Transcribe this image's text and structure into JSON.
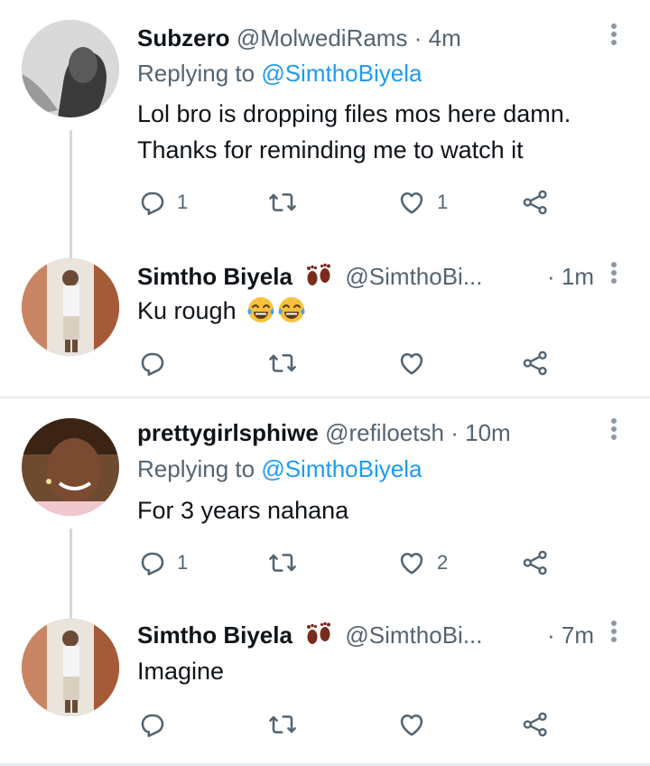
{
  "thread1": {
    "tweet1": {
      "name": "Subzero",
      "handle": "@MolwediRams",
      "separator": "·",
      "time": "4m",
      "replying_prefix": "Replying to",
      "replying_to": "@SimthoBiyela",
      "text_line1": "Lol bro is dropping files mos here damn.",
      "text_line2": "Thanks for reminding me to watch it",
      "reply_count": "1",
      "retweet_count": "",
      "like_count": "1"
    },
    "tweet2": {
      "name": "Simtho Biyela",
      "handle": "@SimthoBi...",
      "time_full": "· 1m",
      "text": "Ku rough",
      "reply_count": "",
      "retweet_count": "",
      "like_count": ""
    }
  },
  "thread2": {
    "tweet1": {
      "name": "prettygirlsphiwe",
      "handle": "@refiloetsh",
      "separator": "·",
      "time": "10m",
      "replying_prefix": "Replying to",
      "replying_to": "@SimthoBiyela",
      "text": "For 3 years nahana",
      "reply_count": "1",
      "retweet_count": "",
      "like_count": "2"
    },
    "tweet2": {
      "name": "Simtho Biyela",
      "handle": "@SimthoBi...",
      "time_full": "· 7m",
      "text": "Imagine",
      "reply_count": "",
      "retweet_count": "",
      "like_count": ""
    }
  },
  "icons": [
    "reply-icon",
    "retweet-icon",
    "like-icon",
    "share-icon",
    "more-icon",
    "footprints-emoji",
    "tears-of-joy-emoji"
  ],
  "colors": {
    "link": "#1d9bf0",
    "secondary_text": "#536471",
    "primary_text": "#0f1419",
    "divider": "#e6ecf0"
  }
}
